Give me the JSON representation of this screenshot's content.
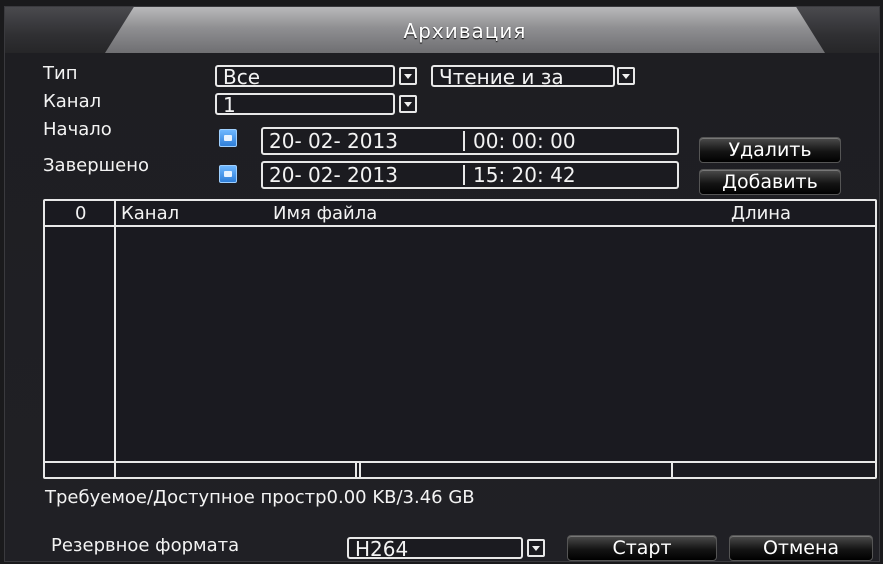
{
  "window": {
    "title": "Архивация"
  },
  "form": {
    "type_label": "Тип",
    "type_value": "Все",
    "mode_value": "Чтение и за",
    "channel_label": "Канал",
    "channel_value": "1",
    "start_label": "Начало",
    "start_date": "20- 02- 2013",
    "start_time": "00: 00: 00",
    "end_label": "Завершено",
    "end_date": "20- 02- 2013",
    "end_time": "15: 20: 42"
  },
  "buttons": {
    "delete": "Удалить",
    "add": "Добавить",
    "start": "Старт",
    "cancel": "Отмена"
  },
  "table": {
    "columns": [
      "0",
      "Канал",
      "Имя файла",
      "Длина"
    ],
    "rows": []
  },
  "space": {
    "text": "Требуемое/Доступное простр0.00 KB/3.46 GB"
  },
  "backup": {
    "label": "Резервное формата",
    "format_value": "H264"
  },
  "icons": {
    "calendar": "calendar-icon",
    "dropdown": "chevron-down-icon"
  },
  "colors": {
    "background": "#1e1e22",
    "border": "#e8e8e8",
    "title_tab": "#a6a6a8"
  }
}
